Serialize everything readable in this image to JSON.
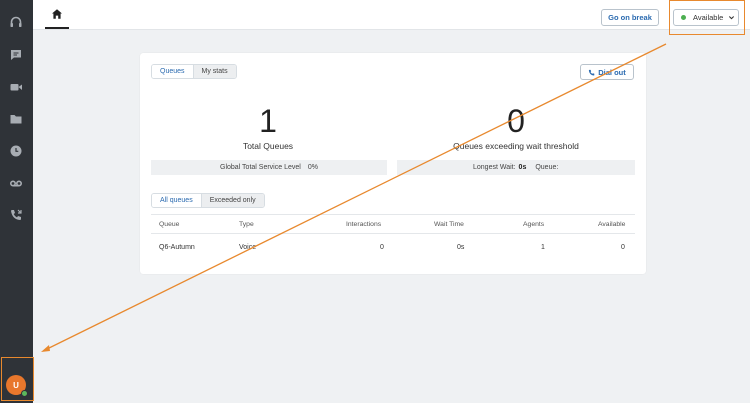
{
  "sidebar": {
    "icons": [
      "headset-icon",
      "chat-icon",
      "video-icon",
      "folder-icon",
      "history-icon",
      "voicemail-icon",
      "callback-icon"
    ],
    "avatar_initial": "U"
  },
  "topbar": {
    "go_on_break": "Go on break",
    "status_label": "Available"
  },
  "card": {
    "tabs": [
      "Queues",
      "My stats"
    ],
    "dial_out": "Dial out",
    "total_queues_value": "1",
    "total_queues_label": "Total Queues",
    "exceeding_value": "0",
    "exceeding_label": "Queues exceeding wait threshold",
    "global_service_label": "Global Total Service Level",
    "global_service_value": "0%",
    "longest_wait_label": "Longest Wait:",
    "longest_wait_value": "0s",
    "queue_label": "Queue:",
    "filter_tabs": [
      "All queues",
      "Exceeded only"
    ],
    "table": {
      "headers": [
        "Queue",
        "Type",
        "Interactions",
        "Wait Time",
        "Agents",
        "Available"
      ],
      "rows": [
        [
          "Q6-Autumn",
          "Voice",
          "0",
          "0s",
          "1",
          "0"
        ]
      ]
    }
  },
  "colors": {
    "accent": "#2a6ab0",
    "annotation": "#e8892e",
    "status_green": "#4caf50",
    "sidebar_bg": "#2f3338"
  }
}
